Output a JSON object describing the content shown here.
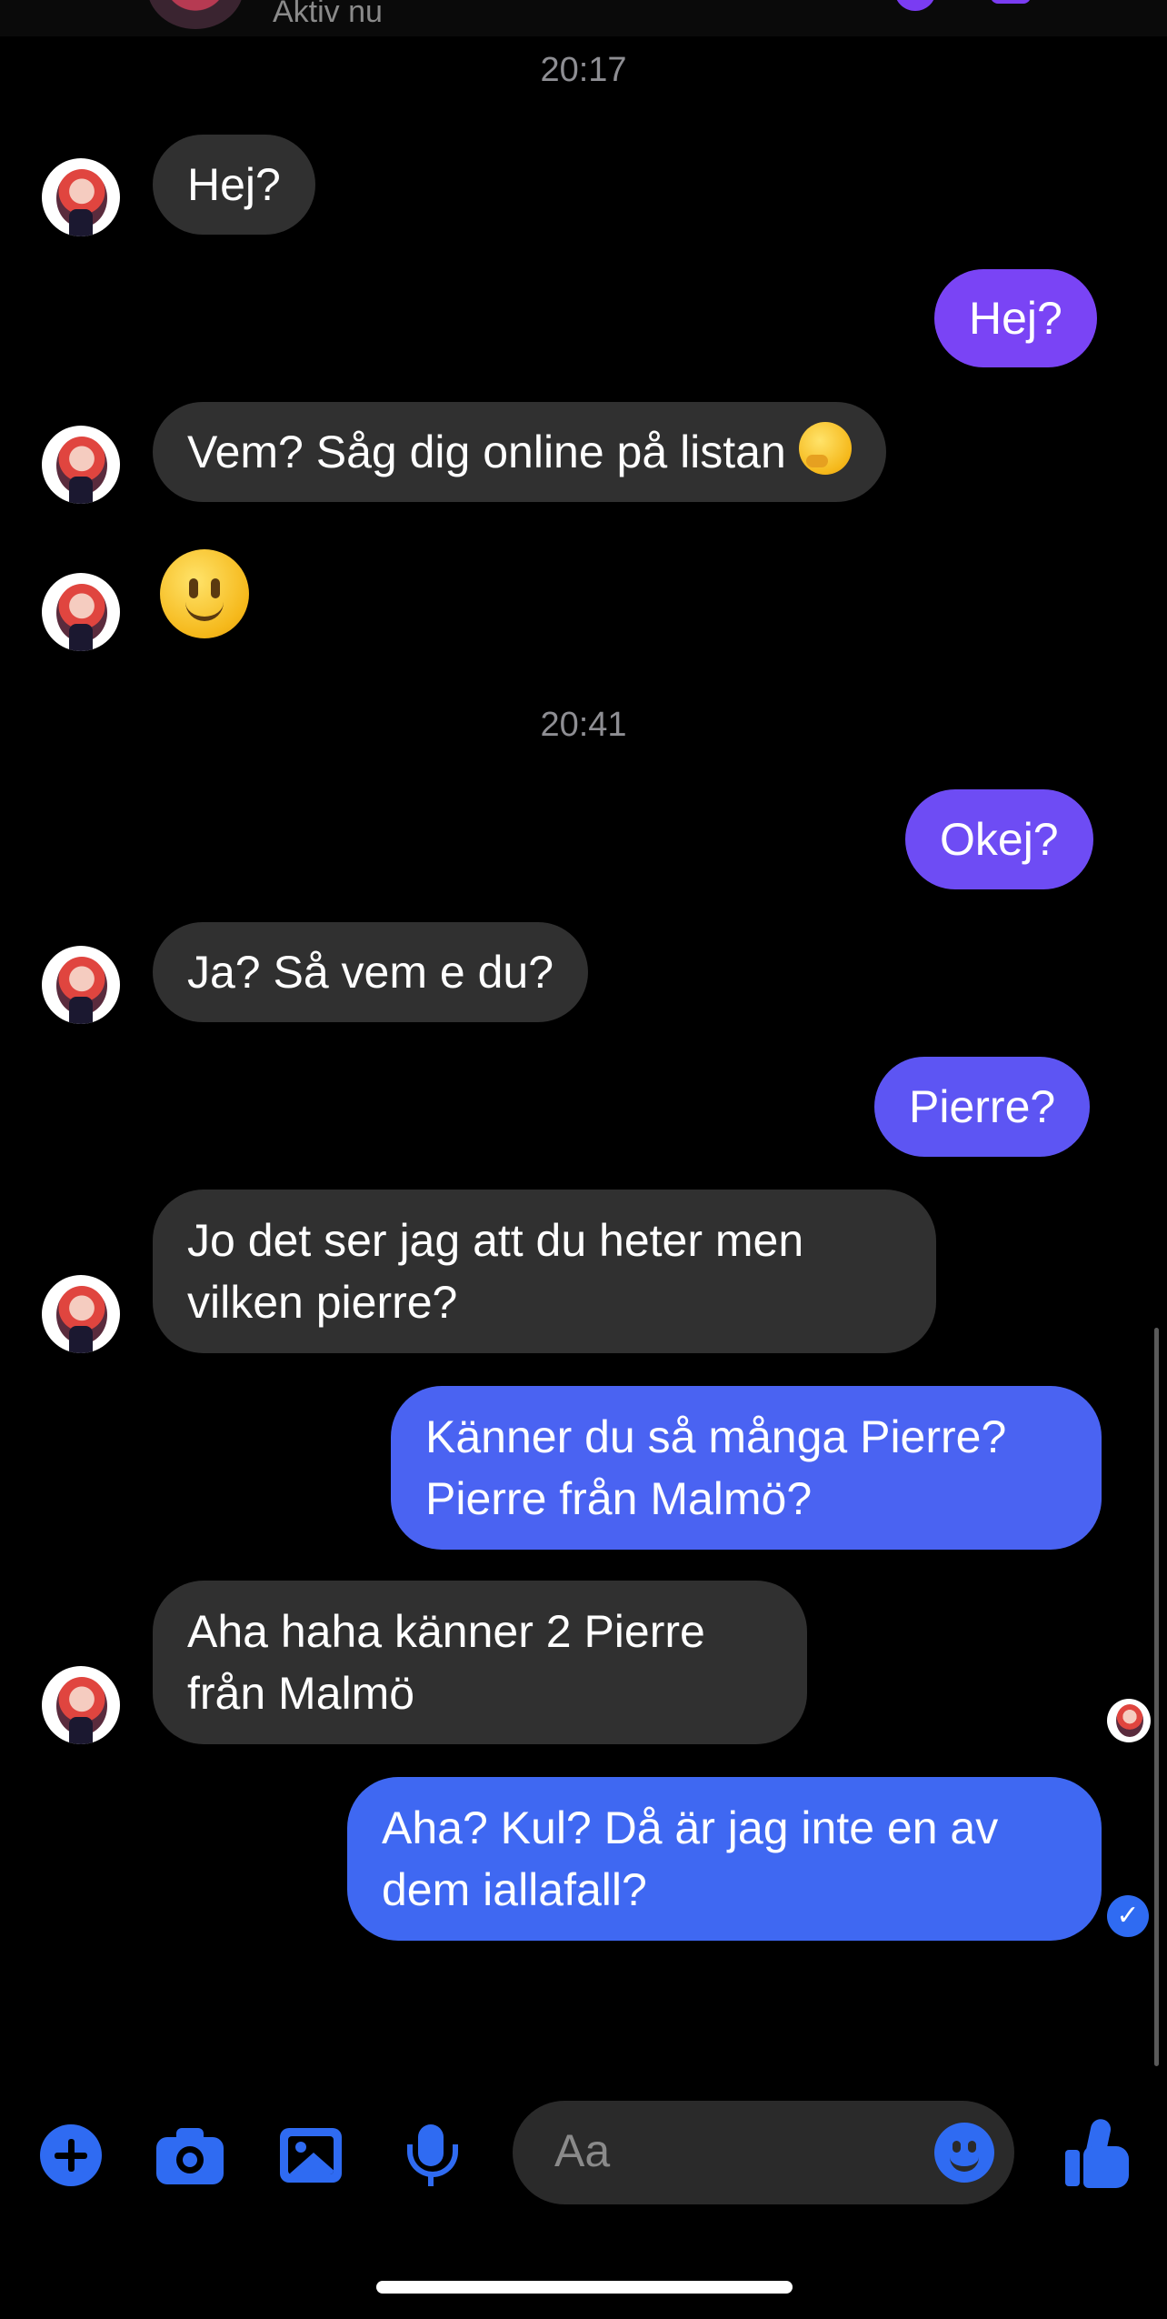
{
  "header": {
    "status_text": "Aktiv nu"
  },
  "conversation": {
    "timestamps": [
      "20:17",
      "20:41"
    ],
    "messages": [
      {
        "side": "incoming",
        "text": "Hej?"
      },
      {
        "side": "outgoing",
        "text": "Hej?"
      },
      {
        "side": "incoming",
        "text": "Vem? Såg dig online på listan",
        "emoji": "thinking-face"
      },
      {
        "side": "incoming",
        "emoji": "slightly-smiling-face"
      },
      {
        "side": "outgoing",
        "text": "Okej?"
      },
      {
        "side": "incoming",
        "text": "Ja? Så vem e du?"
      },
      {
        "side": "outgoing",
        "text": "Pierre?"
      },
      {
        "side": "incoming",
        "text": "Jo det ser jag att du heter men\nvilken pierre?"
      },
      {
        "side": "outgoing",
        "text": "Känner du så många Pierre?\nPierre från Malmö?"
      },
      {
        "side": "incoming",
        "text": "Aha haha känner 2 Pierre\nfrån Malmö"
      },
      {
        "side": "outgoing",
        "text": "Aha? Kul? Då är jag inte en av\ndem iallafall?"
      }
    ]
  },
  "composer": {
    "placeholder": "Aa"
  },
  "colors": {
    "background": "#000000",
    "incoming_bubble": "#303030",
    "outgoing_purple": "#7848f4",
    "outgoing_blue": "#3f68f2",
    "accent": "#2f6bf2"
  },
  "icons": [
    "plus-icon",
    "camera-icon",
    "photo-icon",
    "microphone-icon",
    "emoji-icon",
    "like-icon",
    "seen-check-icon"
  ]
}
